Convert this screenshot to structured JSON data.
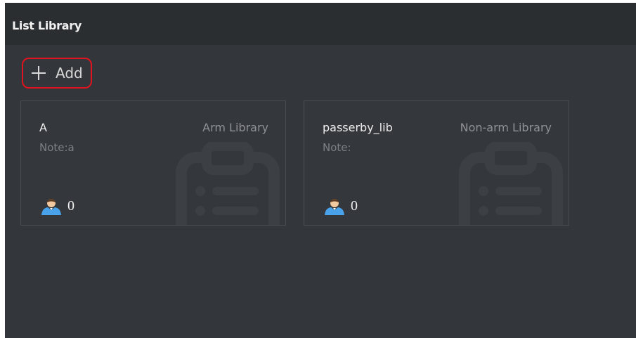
{
  "header": {
    "title": "List Library"
  },
  "toolbar": {
    "add_label": "Add",
    "add_icon": "plus-icon",
    "highlight_color": "#e0141e"
  },
  "cards": [
    {
      "name": "A",
      "type": "Arm Library",
      "note": "Note:a",
      "count": "0",
      "icon": "person-icon",
      "background_icon": "clipboard-icon"
    },
    {
      "name": "passerby_lib",
      "type": "Non-arm Library",
      "note": "Note:",
      "count": "0",
      "icon": "person-icon",
      "background_icon": "clipboard-icon"
    }
  ],
  "colors": {
    "panel_background": "#33363a",
    "header_background": "#2b2e31",
    "user_icon_accent": "#4aa3ea"
  }
}
